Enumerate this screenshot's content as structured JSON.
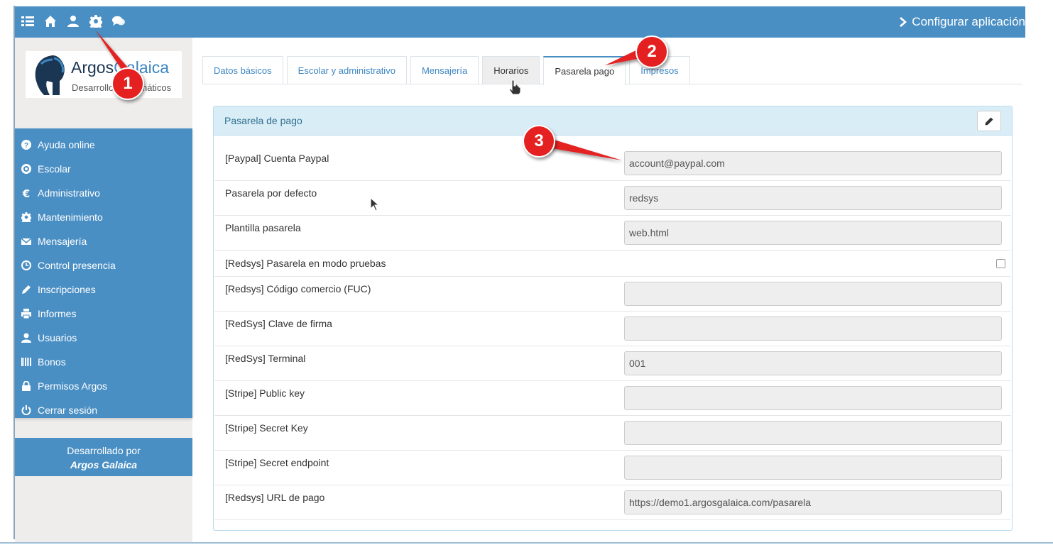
{
  "topbar": {
    "icons": [
      "list-icon",
      "home-icon",
      "user-icon",
      "gear-icon",
      "chat-icon"
    ],
    "config_label": "Configurar aplicación"
  },
  "logo": {
    "brand_part1": "Argos",
    "brand_part2": "Galaica",
    "tagline": "Desarrollos Informáticos"
  },
  "sidebar": {
    "items": [
      {
        "label": "Ayuda online",
        "icon": "question-circle-icon"
      },
      {
        "label": "Escolar",
        "icon": "clock-circle-icon"
      },
      {
        "label": "Administrativo",
        "icon": "euro-icon"
      },
      {
        "label": "Mantenimiento",
        "icon": "gear-icon"
      },
      {
        "label": "Mensajería",
        "icon": "envelope-icon"
      },
      {
        "label": "Control presencia",
        "icon": "clock-icon"
      },
      {
        "label": "Inscripciones",
        "icon": "pencil-icon"
      },
      {
        "label": "Informes",
        "icon": "print-icon"
      },
      {
        "label": "Usuarios",
        "icon": "user-icon"
      },
      {
        "label": "Bonos",
        "icon": "barcode-icon"
      },
      {
        "label": "Permisos Argos",
        "icon": "lock-icon"
      },
      {
        "label": "Cerrar sesión",
        "icon": "power-icon"
      }
    ],
    "credit_line1": "Desarrollado por",
    "credit_line2": "Argos Galaica"
  },
  "tabs": [
    {
      "label": "Datos básicos",
      "state": "normal"
    },
    {
      "label": "Escolar y administrativo",
      "state": "normal"
    },
    {
      "label": "Mensajería",
      "state": "normal"
    },
    {
      "label": "Horarios",
      "state": "hover"
    },
    {
      "label": "Pasarela pago",
      "state": "active"
    },
    {
      "label": "Impresos",
      "state": "normal"
    }
  ],
  "panel": {
    "title": "Pasarela de pago",
    "rows": [
      {
        "label": "[Paypal] Cuenta Paypal",
        "type": "text",
        "value": "account@paypal.com"
      },
      {
        "label": "Pasarela por defecto",
        "type": "text",
        "value": "redsys"
      },
      {
        "label": "Plantilla pasarela",
        "type": "text",
        "value": "web.html"
      },
      {
        "label": "[Redsys] Pasarela en modo pruebas",
        "type": "checkbox",
        "checked": false
      },
      {
        "label": "[Redsys] Código comercio (FUC)",
        "type": "text",
        "value": ""
      },
      {
        "label": "[RedSys] Clave de firma",
        "type": "text",
        "value": ""
      },
      {
        "label": "[RedSys] Terminal",
        "type": "text",
        "value": "001"
      },
      {
        "label": "[Stripe] Public key",
        "type": "text",
        "value": ""
      },
      {
        "label": "[Stripe] Secret Key",
        "type": "text",
        "value": ""
      },
      {
        "label": "[Stripe] Secret endpoint",
        "type": "text",
        "value": ""
      },
      {
        "label": "[Redsys] URL de pago",
        "type": "text",
        "value": "https://demo1.argosgalaica.com/pasarela"
      }
    ]
  },
  "callouts": [
    "1",
    "2",
    "3"
  ],
  "colors": {
    "primary": "#4a8fc4",
    "panel_heading": "#d9edf7",
    "callout": "#e52020"
  }
}
